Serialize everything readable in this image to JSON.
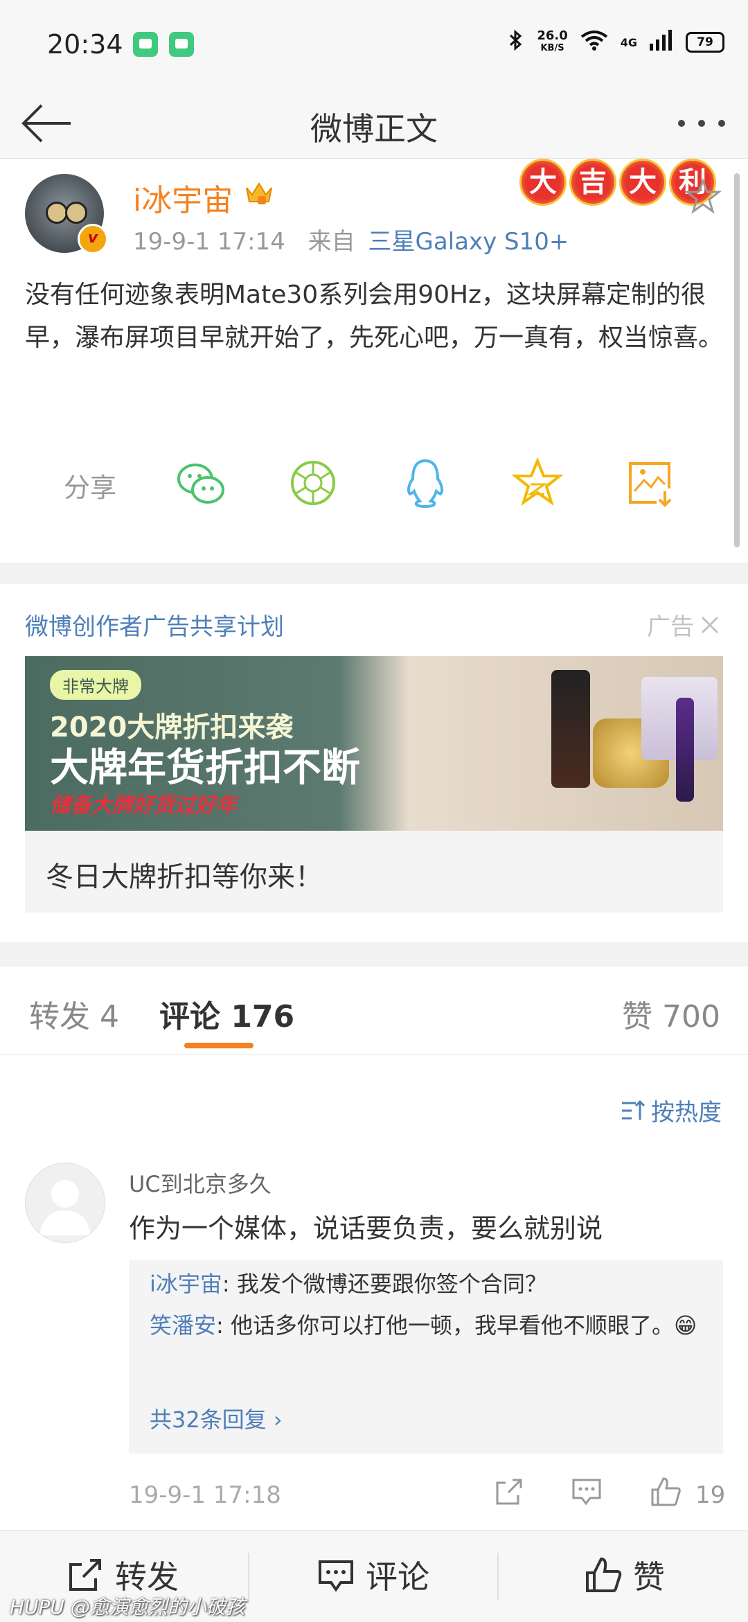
{
  "status_bar": {
    "time": "20:34",
    "net_speed_value": "26.0",
    "net_speed_unit": "KB/S",
    "network": "4G",
    "battery": "79"
  },
  "nav": {
    "title": "微博正文",
    "back_icon": "arrow-left-icon",
    "more_icon": "more-dots-icon"
  },
  "post": {
    "author": "i冰宇宙",
    "date": "19-9-1 17:14",
    "from_label": "来自",
    "source": "三星Galaxy S10+",
    "fortune": [
      "大",
      "吉",
      "大",
      "利"
    ],
    "text": "没有任何迹象表明Mate30系列会用90Hz，这块屏幕定制的很早，瀑布屏项目早就开始了，先死心吧，万一真有，权当惊喜。",
    "share_label": "分享",
    "share_targets": [
      "wechat-icon",
      "moments-icon",
      "qq-icon",
      "favorite-icon",
      "save-image-icon"
    ]
  },
  "ad": {
    "plan": "微博创作者广告共享计划",
    "tag": "广告",
    "banner_pill": "非常大牌",
    "banner_line1": "2020大牌折扣来袭",
    "banner_line2": "大牌年货折扣不断",
    "banner_line3": "储备大牌好货过好年",
    "caption": "冬日大牌折扣等你来！"
  },
  "tabs": {
    "repost": "转发 4",
    "comments": "评论 176",
    "likes": "赞 700"
  },
  "comments_section": {
    "sort_label": "按热度",
    "items": [
      {
        "user": "UC到北京多久",
        "text": "作为一个媒体，说话要负责，要么就别说",
        "replies": [
          {
            "user": "i冰宇宙",
            "text": ": 我发个微博还要跟你签个合同？"
          },
          {
            "user": "笑潘安",
            "text": ": 他话多你可以打他一顿，我早看他不顺眼了。😁"
          }
        ],
        "more_replies": "共32条回复 ›",
        "time": "19-9-1 17:18",
        "likes": "19"
      }
    ]
  },
  "bottom_bar": {
    "repost": "转发",
    "comment": "评论",
    "like": "赞"
  },
  "watermark": "HUPU @愈演愈烈的小破孩",
  "colors": {
    "accent_orange": "#f5811f",
    "link_blue": "#4e7fb8",
    "text_dark": "#333333",
    "text_muted": "#999999"
  }
}
